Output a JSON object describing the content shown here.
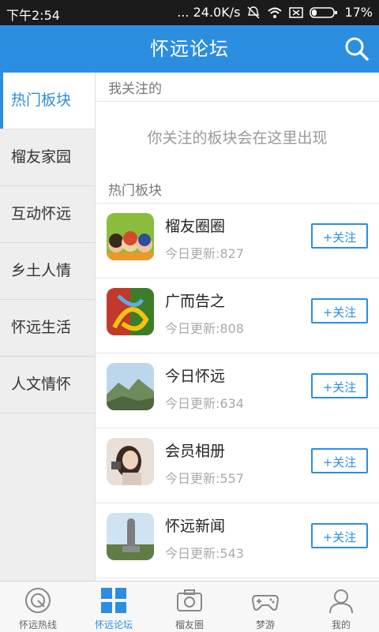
{
  "status": {
    "time": "下午2:54",
    "net": "... 24.0K/s",
    "battery": "17%"
  },
  "header": {
    "title": "怀远论坛"
  },
  "sidebar": {
    "items": [
      "热门板块",
      "榴友家园",
      "互动怀远",
      "乡土人情",
      "怀远生活",
      "人文情怀"
    ]
  },
  "main": {
    "follow_header": "我关注的",
    "empty_text": "你关注的板块会在这里出现",
    "hot_header": "热门板块",
    "boards": [
      {
        "name": "榴友圈圈",
        "updates": "今日更新:827",
        "button": "+关注"
      },
      {
        "name": "广而告之",
        "updates": "今日更新:808",
        "button": "+关注"
      },
      {
        "name": "今日怀远",
        "updates": "今日更新:634",
        "button": "+关注"
      },
      {
        "name": "会员相册",
        "updates": "今日更新:557",
        "button": "+关注"
      },
      {
        "name": "怀远新闻",
        "updates": "今日更新:543",
        "button": "+关注"
      }
    ]
  },
  "tabs": [
    {
      "label": "怀远热线",
      "icon": "radio-icon"
    },
    {
      "label": "怀远论坛",
      "icon": "grid-icon"
    },
    {
      "label": "榴友圈",
      "icon": "camera-icon"
    },
    {
      "label": "梦游",
      "icon": "gamepad-icon"
    },
    {
      "label": "我的",
      "icon": "user-icon"
    }
  ],
  "colors": {
    "accent": "#2b8ee0"
  }
}
